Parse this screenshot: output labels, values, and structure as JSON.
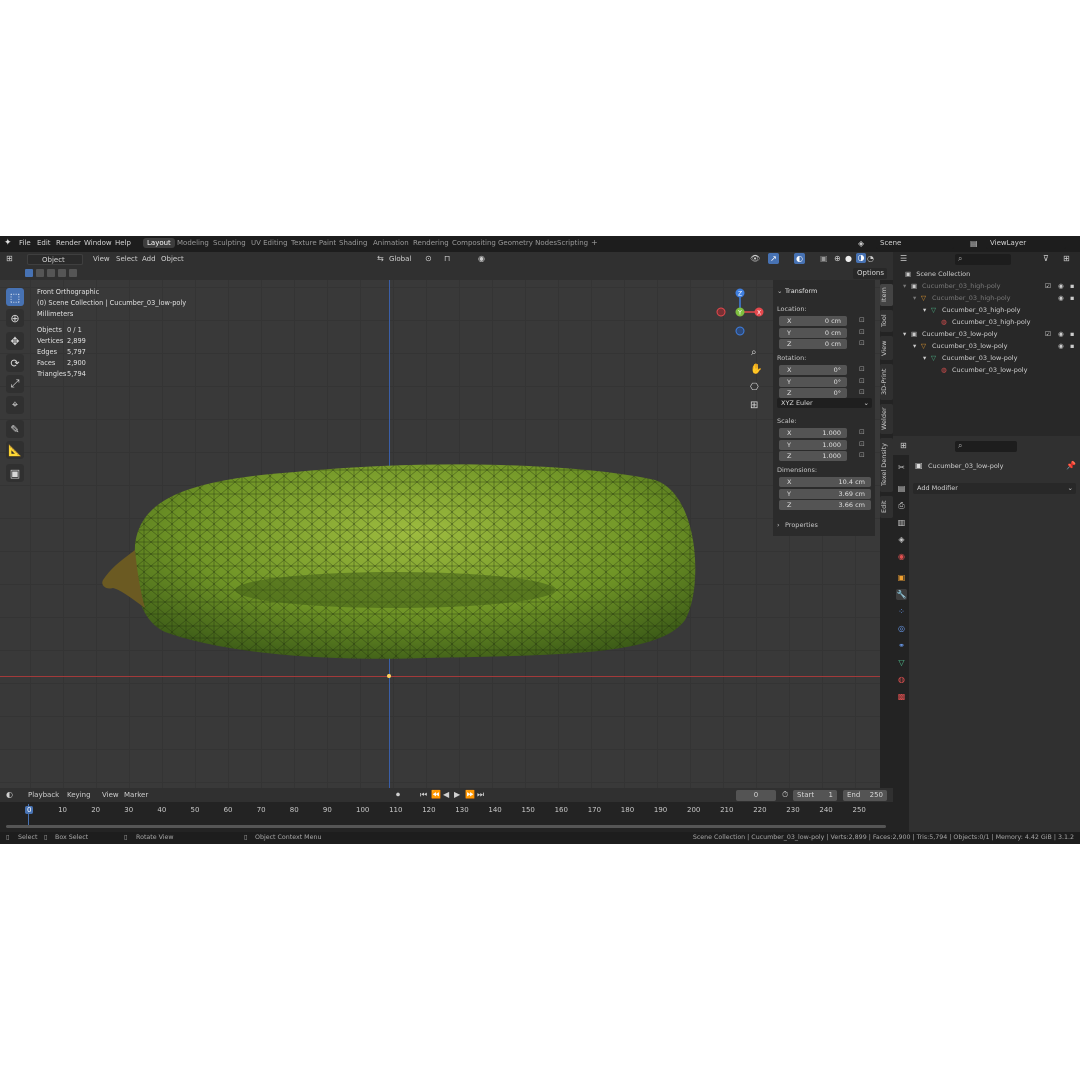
{
  "topbar": {
    "menus": [
      "File",
      "Edit",
      "Render",
      "Window",
      "Help"
    ],
    "workspaces": [
      "Layout",
      "Modeling",
      "Sculpting",
      "UV Editing",
      "Texture Paint",
      "Shading",
      "Animation",
      "Rendering",
      "Compositing",
      "Geometry Nodes",
      "Scripting"
    ],
    "add_tab": "+",
    "scene": "Scene",
    "view_layer": "ViewLayer"
  },
  "viewport_header": {
    "mode": "Object Mode",
    "menus": [
      "View",
      "Select",
      "Add",
      "Object"
    ],
    "orientation": "Global",
    "options": "Options"
  },
  "viewport": {
    "view_name": "Front Orthographic",
    "collection_line": "(0) Scene Collection | Cucumber_03_low-poly",
    "units": "Millimeters",
    "stats": [
      {
        "label": "Objects",
        "value": "0 / 1"
      },
      {
        "label": "Vertices",
        "value": "2,899"
      },
      {
        "label": "Edges",
        "value": "5,797"
      },
      {
        "label": "Faces",
        "value": "2,900"
      },
      {
        "label": "Triangles",
        "value": "5,794"
      }
    ],
    "gizmo": {
      "z": "Z",
      "y": "Y",
      "x": "X"
    }
  },
  "npanel": {
    "transform": "Transform",
    "location_label": "Location:",
    "location": [
      {
        "axis": "X",
        "value": "0 cm"
      },
      {
        "axis": "Y",
        "value": "0 cm"
      },
      {
        "axis": "Z",
        "value": "0 cm"
      }
    ],
    "rotation_label": "Rotation:",
    "rotation": [
      {
        "axis": "X",
        "value": "0°"
      },
      {
        "axis": "Y",
        "value": "0°"
      },
      {
        "axis": "Z",
        "value": "0°"
      }
    ],
    "rotation_mode": "XYZ Euler",
    "scale_label": "Scale:",
    "scale": [
      {
        "axis": "X",
        "value": "1.000"
      },
      {
        "axis": "Y",
        "value": "1.000"
      },
      {
        "axis": "Z",
        "value": "1.000"
      }
    ],
    "dimensions_label": "Dimensions:",
    "dimensions": [
      {
        "axis": "X",
        "value": "10.4 cm"
      },
      {
        "axis": "Y",
        "value": "3.69 cm"
      },
      {
        "axis": "Z",
        "value": "3.66 cm"
      }
    ],
    "properties": "Properties",
    "tabs": [
      "Item",
      "Tool",
      "View",
      "3D-Print",
      "Welder",
      "Texel Density",
      "Edit"
    ]
  },
  "outliner": {
    "root": "Scene Collection",
    "rows": [
      {
        "label": "Cucumber_03_high-poly",
        "indent": 1,
        "dim": true
      },
      {
        "label": "Cucumber_03_high-poly",
        "indent": 2,
        "dim": true
      },
      {
        "label": "Cucumber_03_high-poly",
        "indent": 3,
        "dim": false
      },
      {
        "label": "Cucumber_03_high-poly",
        "indent": 4,
        "dim": false
      },
      {
        "label": "Cucumber_03_low-poly",
        "indent": 1,
        "dim": false
      },
      {
        "label": "Cucumber_03_low-poly",
        "indent": 2,
        "dim": false
      },
      {
        "label": "Cucumber_03_low-poly",
        "indent": 3,
        "dim": false
      },
      {
        "label": "Cucumber_03_low-poly",
        "indent": 4,
        "dim": false
      }
    ]
  },
  "properties": {
    "object_name": "Cucumber_03_low-poly",
    "add_modifier": "Add Modifier"
  },
  "timeline": {
    "menus": [
      "Playback",
      "Keying",
      "View",
      "Marker"
    ],
    "current_frame": "0",
    "start_label": "Start",
    "start": "1",
    "end_label": "End",
    "end": "250",
    "ticks": [
      "0",
      "10",
      "20",
      "30",
      "40",
      "50",
      "60",
      "70",
      "80",
      "90",
      "100",
      "110",
      "120",
      "130",
      "140",
      "150",
      "160",
      "170",
      "180",
      "190",
      "200",
      "210",
      "220",
      "230",
      "240",
      "250"
    ]
  },
  "statusbar": {
    "select": "Select",
    "box_select": "Box Select",
    "rotate_view": "Rotate View",
    "context_menu": "Object Context Menu",
    "info": "Scene Collection | Cucumber_03_low-poly | Verts:2,899 | Faces:2,900 | Tris:5,794 | Objects:0/1 | Memory: 4.42 GiB | 3.1.2"
  },
  "colors": {
    "accent": "#4772b3",
    "cucumber": "#7fa52e",
    "axis_x": "#e5484d",
    "axis_y": "#7fbf3f",
    "axis_z": "#3f7fe0"
  }
}
